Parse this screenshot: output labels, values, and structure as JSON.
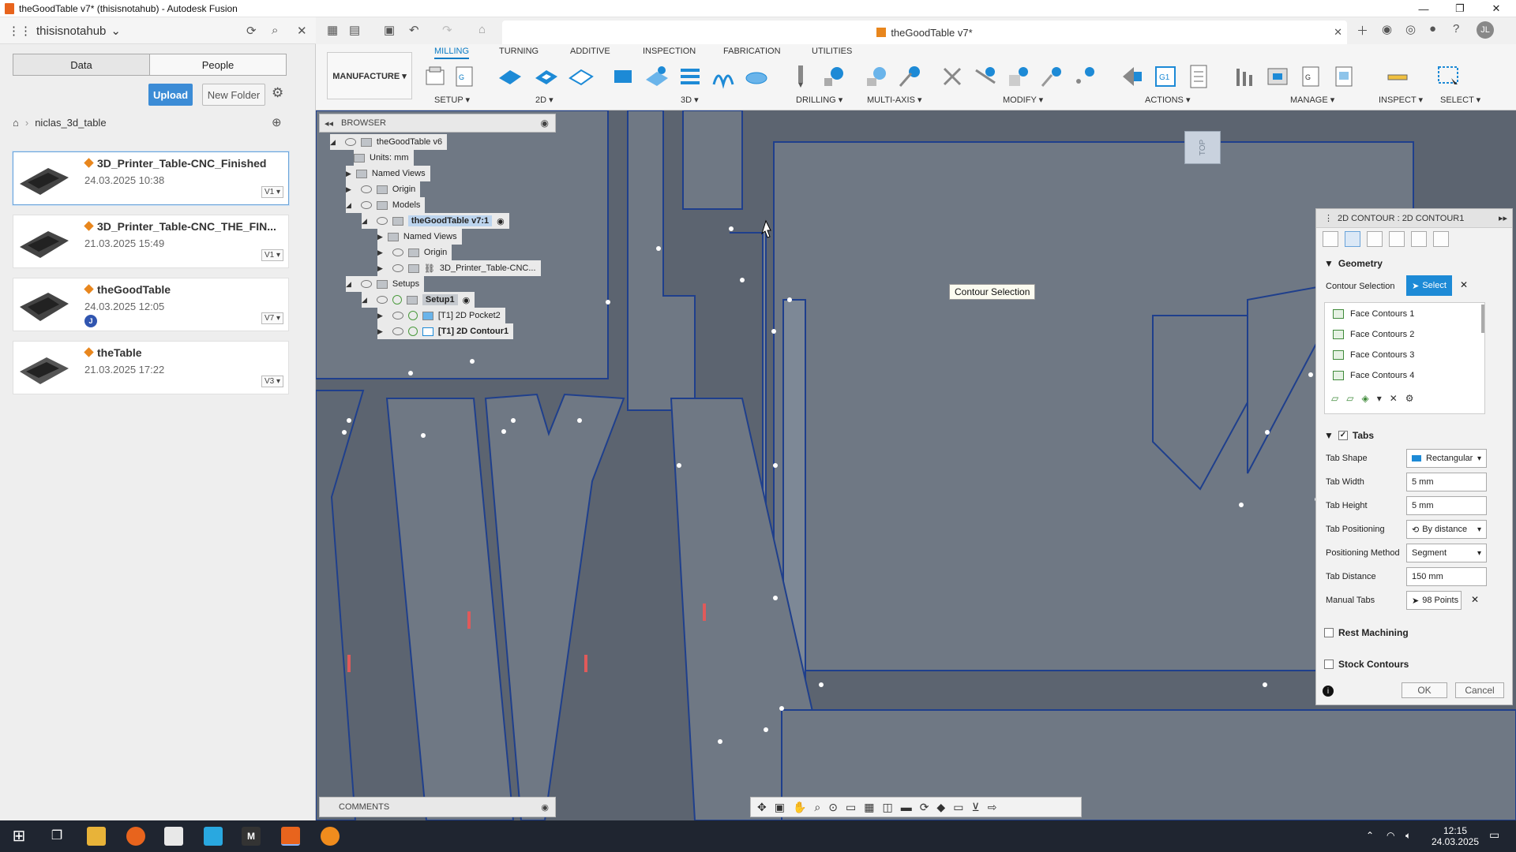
{
  "window": {
    "title": "theGoodTable v7* (thisisnotahub) - Autodesk Fusion",
    "controls": {
      "minimize": "—",
      "restore": "❐",
      "close": "✕"
    }
  },
  "hub": {
    "name": "thisisnotahub"
  },
  "data_panel": {
    "tab_data": "Data",
    "tab_people": "People",
    "upload": "Upload",
    "new_folder": "New Folder",
    "breadcrumb": "niclas_3d_table",
    "files": [
      {
        "name": "3D_Printer_Table-CNC_Finished",
        "date": "24.03.2025 10:38",
        "version": "V1 ▾"
      },
      {
        "name": "3D_Printer_Table-CNC_THE_FIN...",
        "date": "21.03.2025 15:49",
        "version": "V1 ▾"
      },
      {
        "name": "theGoodTable",
        "date": "24.03.2025 12:05",
        "version": "V7 ▾",
        "badge": "J"
      },
      {
        "name": "theTable",
        "date": "21.03.2025 17:22",
        "version": "V3 ▾"
      }
    ]
  },
  "document_tab": {
    "title": "theGoodTable v7*"
  },
  "user_initials": "JL",
  "ribbon": {
    "workspace": "MANUFACTURE ▾",
    "tabs": [
      "MILLING",
      "TURNING",
      "ADDITIVE",
      "INSPECTION",
      "FABRICATION",
      "UTILITIES"
    ],
    "active_tab": "MILLING",
    "groups": [
      "SETUP ▾",
      "2D ▾",
      "3D ▾",
      "DRILLING ▾",
      "MULTI-AXIS ▾",
      "MODIFY ▾",
      "ACTIONS ▾",
      "MANAGE ▾",
      "INSPECT ▾",
      "SELECT ▾"
    ]
  },
  "browser": {
    "title": "BROWSER",
    "items": [
      {
        "label": "theGoodTable v6"
      },
      {
        "label": "Units: mm"
      },
      {
        "label": "Named Views"
      },
      {
        "label": "Origin"
      },
      {
        "label": "Models"
      },
      {
        "label": "theGoodTable v7:1"
      },
      {
        "label": "Named Views"
      },
      {
        "label": "Origin"
      },
      {
        "label": "3D_Printer_Table-CNC..."
      },
      {
        "label": "Setups"
      },
      {
        "label": "Setup1"
      },
      {
        "label": "[T1] 2D Pocket2"
      },
      {
        "label": "[T1] 2D Contour1"
      }
    ]
  },
  "comments": {
    "title": "COMMENTS"
  },
  "tooltip": "Contour Selection",
  "viewcube": {
    "face": "TOP"
  },
  "dialog": {
    "title": "2D CONTOUR : 2D CONTOUR1",
    "geometry_section": "Geometry",
    "contour_selection_label": "Contour Selection",
    "select_button": "Select",
    "contours": [
      "Face Contours 1",
      "Face Contours 2",
      "Face Contours 3",
      "Face Contours 4"
    ],
    "tabs_section": "Tabs",
    "fields": [
      {
        "label": "Tab Shape",
        "value": "Rectangular"
      },
      {
        "label": "Tab Width",
        "value": "5 mm"
      },
      {
        "label": "Tab Height",
        "value": "5 mm"
      },
      {
        "label": "Tab Positioning",
        "value": "By distance"
      },
      {
        "label": "Positioning Method",
        "value": "Segment"
      },
      {
        "label": "Tab Distance",
        "value": "150 mm"
      },
      {
        "label": "Manual Tabs",
        "value": "98 Points"
      }
    ],
    "rest_machining": "Rest Machining",
    "stock_contours": "Stock Contours",
    "ok": "OK",
    "cancel": "Cancel"
  },
  "taskbar": {
    "time": "12:15",
    "date": "24.03.2025"
  },
  "colors": {
    "accent": "#0a7bc4",
    "canvas": "#5c6470",
    "part": "#6f7884",
    "edge": "#1f3f8c",
    "upload": "#3c8cd6"
  }
}
